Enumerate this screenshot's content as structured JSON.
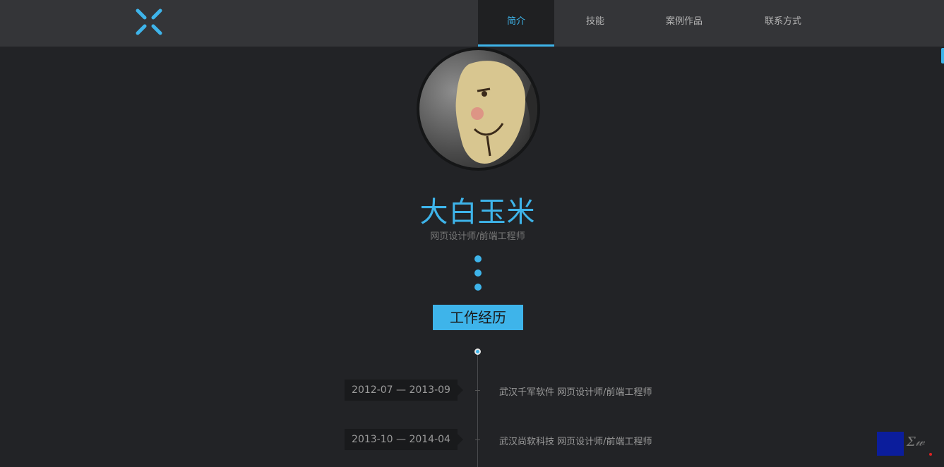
{
  "nav": {
    "items": [
      {
        "label": "简介",
        "active": true
      },
      {
        "label": "技能",
        "active": false
      },
      {
        "label": "案例作品",
        "active": false
      },
      {
        "label": "联系方式",
        "active": false
      }
    ]
  },
  "profile": {
    "name": "大白玉米",
    "title": "网页设计师/前端工程师"
  },
  "section": {
    "label": "工作经历"
  },
  "timeline": [
    {
      "date": "2012-07 — 2013-09",
      "text": "武汉千军软件 网页设计师/前端工程师"
    },
    {
      "date": "2013-10 — 2014-04",
      "text": "武汉尚软科技 网页设计师/前端工程师"
    }
  ],
  "colors": {
    "accent": "#3eb4ea",
    "background": "#222326",
    "topbar": "#343538"
  },
  "icons": {
    "logo": "x-logo-icon"
  }
}
